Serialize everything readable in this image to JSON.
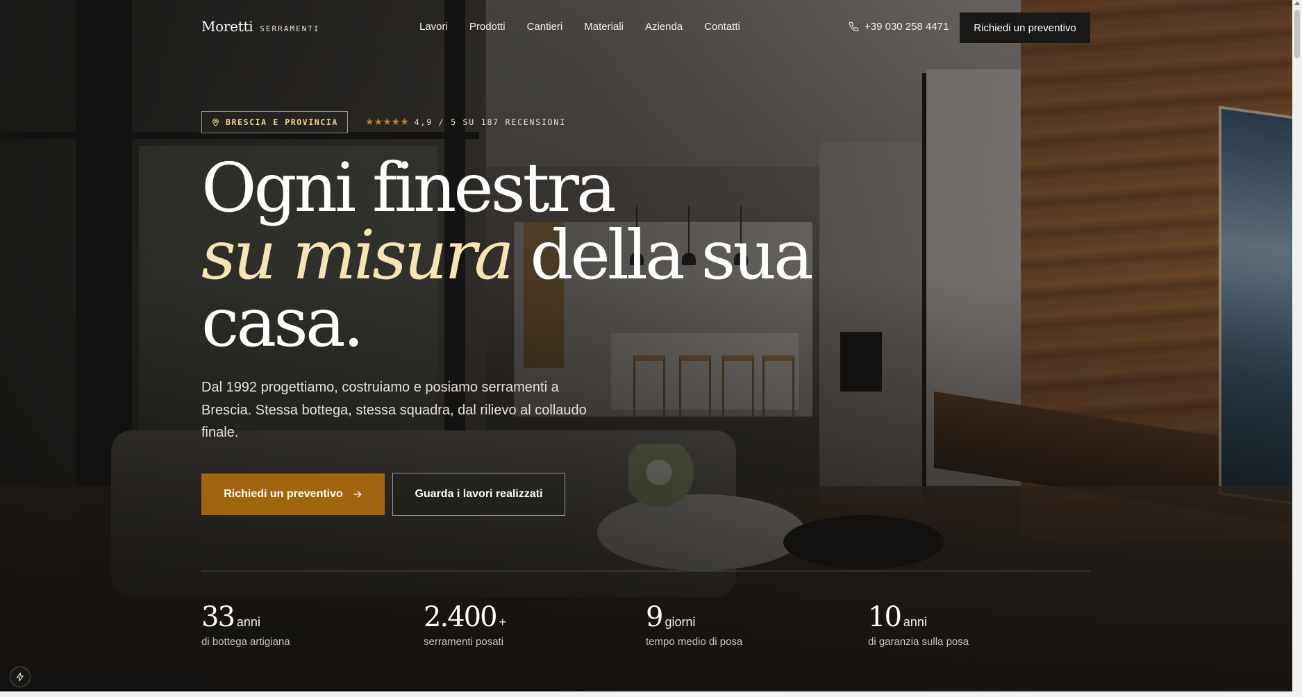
{
  "brand": {
    "name": "Moretti",
    "tagline": "SERRAMENTI"
  },
  "nav": {
    "items": [
      {
        "label": "Lavori"
      },
      {
        "label": "Prodotti"
      },
      {
        "label": "Cantieri"
      },
      {
        "label": "Materiali"
      },
      {
        "label": "Azienda"
      },
      {
        "label": "Contatti"
      }
    ]
  },
  "header": {
    "phone": "+39 030 258 4471",
    "cta_label": "Richiedi un preventivo"
  },
  "badges": {
    "location": "BRESCIA E PROVINCIA",
    "rating_text": "4,9 / 5 SU 187 RECENSIONI",
    "stars": "★★★★★",
    "rating_value": 4.9
  },
  "hero": {
    "headline_line1": "Ogni finestra",
    "headline_accent": "su misura",
    "headline_line2_rest": "della sua",
    "headline_line3": "casa.",
    "lead": "Dal 1992 progettiamo, costruiamo e posiamo serramenti a Brescia. Stessa bottega, stessa squadra, dal rilievo al collaudo finale.",
    "primary_cta": "Richiedi un preventivo",
    "secondary_cta": "Guarda i lavori realizzati"
  },
  "stats": [
    {
      "value": "33",
      "unit": "anni",
      "label": "di bottega artigiana"
    },
    {
      "value": "2.400",
      "unit": "+",
      "label": "serramenti posati"
    },
    {
      "value": "9",
      "unit": "giorni",
      "label": "tempo medio di posa"
    },
    {
      "value": "10",
      "unit": "anni",
      "label": "di garanzia sulla posa"
    }
  ],
  "colors": {
    "accent_gold": "#a2650f",
    "accent_cream": "#f6e4b3",
    "dark": "#1a1816"
  },
  "icons": {
    "phone": "phone-icon",
    "location": "location-pin-icon",
    "arrow": "arrow-right-icon",
    "bolt": "bolt-icon"
  }
}
